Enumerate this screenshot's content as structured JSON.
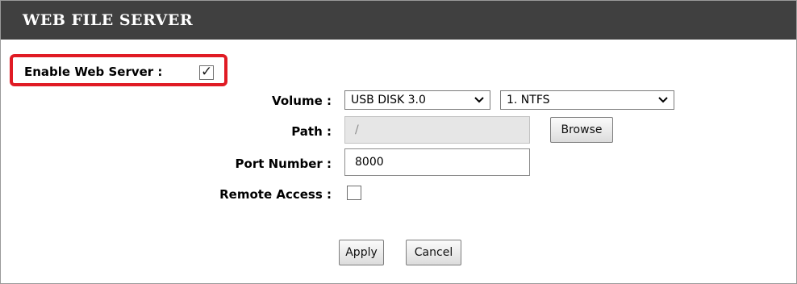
{
  "header": {
    "title": "WEB FILE SERVER"
  },
  "enable_web_server": {
    "label": "Enable Web Server :",
    "checked": true
  },
  "volume": {
    "label": "Volume :",
    "disk_value": "USB DISK 3.0",
    "partition_value": "1. NTFS"
  },
  "path": {
    "label": "Path :",
    "value": "/",
    "browse_label": "Browse"
  },
  "port": {
    "label": "Port Number :",
    "value": "8000"
  },
  "remote_access": {
    "label": "Remote Access :",
    "checked": false
  },
  "actions": {
    "apply_label": "Apply",
    "cancel_label": "Cancel"
  },
  "colors": {
    "header_bg": "#404040",
    "highlight": "#e01b24"
  },
  "icons": {
    "dropdown": "chevron-down-icon",
    "check": "checkmark-icon"
  }
}
